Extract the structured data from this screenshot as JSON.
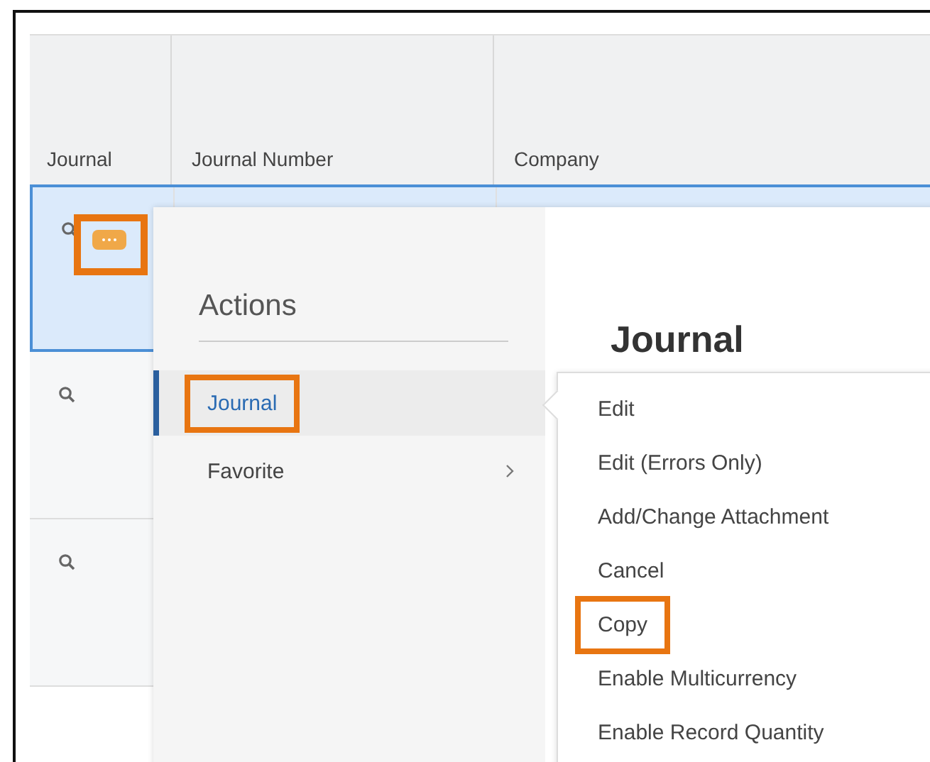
{
  "table": {
    "columns": [
      "Journal",
      "Journal Number",
      "Company"
    ],
    "rows": [
      {
        "selected": true
      },
      {
        "selected": false
      },
      {
        "selected": false
      }
    ]
  },
  "row_actions_button": {
    "highlighted": true
  },
  "actions_menu": {
    "title": "Actions",
    "items": [
      {
        "label": "Journal",
        "selected": true,
        "expanded": true,
        "highlighted": true
      },
      {
        "label": "Favorite",
        "selected": false,
        "expanded": false,
        "highlighted": false
      }
    ]
  },
  "panel": {
    "title": "Journal"
  },
  "submenu": {
    "items": [
      {
        "label": "Edit",
        "highlighted": false
      },
      {
        "label": "Edit (Errors Only)",
        "highlighted": false
      },
      {
        "label": "Add/Change Attachment",
        "highlighted": false
      },
      {
        "label": "Cancel",
        "highlighted": false
      },
      {
        "label": "Copy",
        "highlighted": true
      },
      {
        "label": "Enable Multicurrency",
        "highlighted": false
      },
      {
        "label": "Enable Record Quantity",
        "highlighted": false
      }
    ]
  }
}
